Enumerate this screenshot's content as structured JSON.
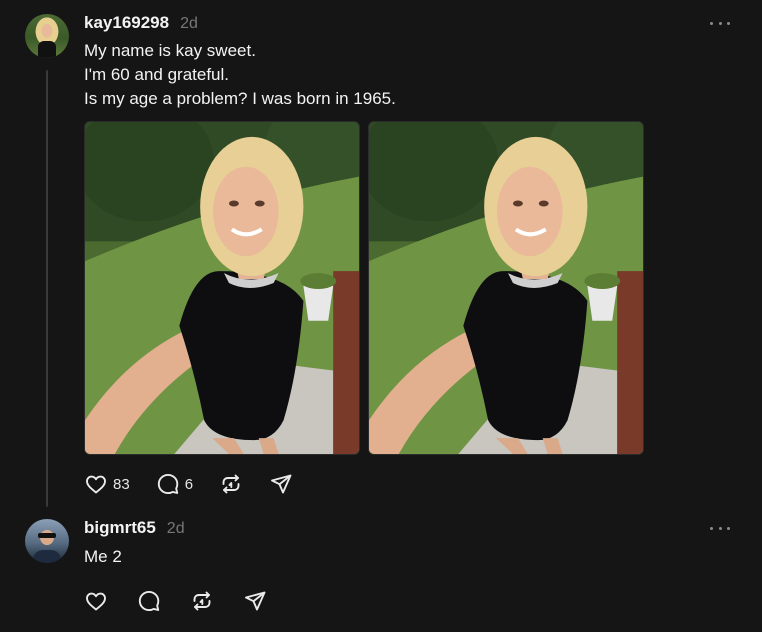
{
  "posts": [
    {
      "username": "kay169298",
      "timestamp": "2d",
      "text_lines": [
        "My name is kay sweet.",
        "I'm 60 and grateful.",
        "Is my age a problem? I was born in 1965."
      ],
      "likes": "83",
      "replies": "6",
      "icons": [
        "heart-icon",
        "comment-icon",
        "repost-icon",
        "share-icon",
        "more-icon"
      ]
    },
    {
      "username": "bigmrt65",
      "timestamp": "2d",
      "text_lines": [
        "Me 2"
      ],
      "icons": [
        "heart-icon",
        "comment-icon",
        "repost-icon",
        "share-icon",
        "more-icon"
      ]
    }
  ],
  "colors": {
    "background": "#151515",
    "text": "#f3f3f3",
    "muted": "#777777",
    "thread_line": "#3a3a3a"
  }
}
